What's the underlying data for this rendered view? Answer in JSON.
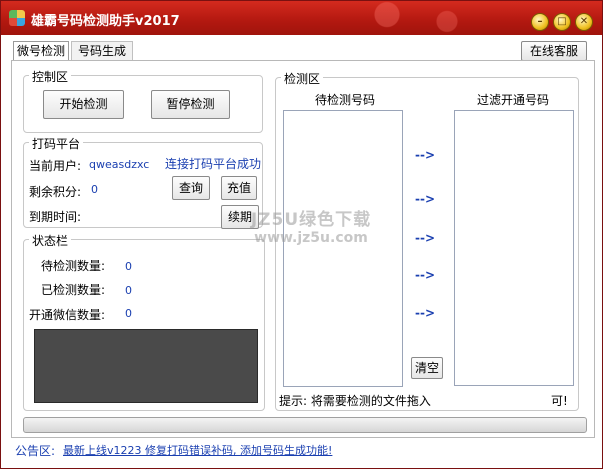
{
  "window": {
    "title": "雄霸号码检测助手v2017"
  },
  "tabs": [
    {
      "label": "微号检测"
    },
    {
      "label": "号码生成"
    }
  ],
  "online_service": "在线客服",
  "control": {
    "title": "控制区",
    "start_button": "开始检测",
    "pause_button": "暂停检测"
  },
  "dama": {
    "title": "打码平台",
    "user_label": "当前用户:",
    "user_value": "qweasdzxc",
    "status": "连接打码平台成功",
    "points_label": "剩余积分:",
    "points_value": "0",
    "expire_label": "到期时间:",
    "query_button": "查询",
    "recharge_button": "充值",
    "renew_button": "续期"
  },
  "status_bar": {
    "title": "状态栏",
    "pending_label": "待检测数量:",
    "pending_value": "0",
    "checked_label": "已检测数量:",
    "checked_value": "0",
    "wechat_label": "开通微信数量:",
    "wechat_value": "0"
  },
  "detect": {
    "title": "检测区",
    "pending_header": "待检测号码",
    "filtered_header": "过滤开通号码",
    "arrow": "-->",
    "clear_button": "清空",
    "tip": "提示: 将需要检测的文件拖入",
    "tip_tail": "可!"
  },
  "watermark": {
    "line1": "JZ5U绿色下载",
    "line2": "www.jz5u.com"
  },
  "announcement": {
    "label": "公告区:",
    "text": "最新上线v1223 修复打码错误补码, 添加号码生成功能!"
  }
}
